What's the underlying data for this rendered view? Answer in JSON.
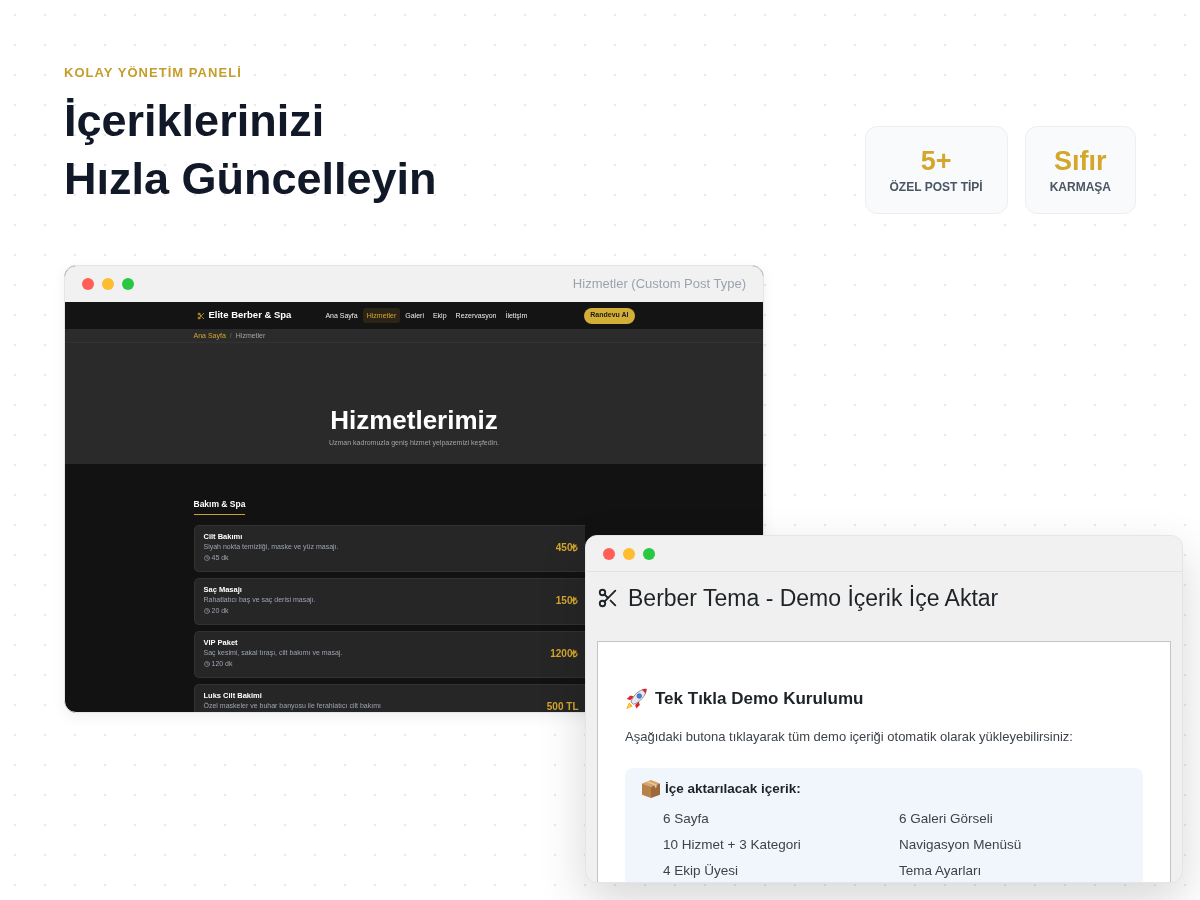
{
  "eyebrow": "KOLAY YÖNETİM PANELİ",
  "heading": [
    "İçeriklerinizi",
    "Hızla Güncelleyin"
  ],
  "stats": [
    {
      "value": "5+",
      "label": "ÖZEL POST TİPİ"
    },
    {
      "value": "Sıfır",
      "label": "KARMAŞA"
    }
  ],
  "preview_window": {
    "title": "Hizmetler (Custom Post Type)",
    "site": {
      "brand": "Elite Berber & Spa",
      "nav": [
        {
          "label": "Ana Sayfa",
          "selected": false
        },
        {
          "label": "Hizmetler",
          "selected": true
        },
        {
          "label": "Galeri",
          "selected": false
        },
        {
          "label": "Ekip",
          "selected": false
        },
        {
          "label": "Rezervasyon",
          "selected": false
        },
        {
          "label": "İletişim",
          "selected": false
        }
      ],
      "cta": "Randevu Al",
      "breadcrumb": [
        {
          "label": "Ana Sayfa",
          "kind": "link"
        },
        {
          "label": "/",
          "kind": "separator"
        },
        {
          "label": "Hizmetler",
          "kind": "current"
        }
      ],
      "hero": {
        "title": "Hizmetlerimiz",
        "subtitle": "Uzman kadromuzla geniş hizmet yelpazemizi keşfedin."
      },
      "category": "Bakım & Spa",
      "services": [
        {
          "name": "Cilt Bakımı",
          "description": "Siyah nokta temizliği, maske ve yüz masajı.",
          "duration": "45 dk",
          "price": "450₺"
        },
        {
          "name": "Saç Masajı",
          "description": "Rahatlatıcı baş ve saç derisi masajı.",
          "duration": "20 dk",
          "price": "150₺"
        },
        {
          "name": "VIP Paket",
          "description": "Saç kesimi, sakal tıraşı, cilt bakımı ve masaj.",
          "duration": "120 dk",
          "price": "1200₺"
        },
        {
          "name": "Luks Cilt Bakimi",
          "description": "Özel maskeler ve buhar banyosu ile ferahlatıcı cilt bakımı",
          "price": "500 TL"
        }
      ]
    }
  },
  "import_window": {
    "title": "Berber Tema - Demo İçerik İçe Aktar",
    "panel": {
      "heading": "Tek Tıkla Demo Kurulumu",
      "text": "Aşağıdaki butona tıklayarak tüm demo içeriği otomatik olarak yükleyebilirsiniz:",
      "info": {
        "heading": "İçe aktarılacak içerik:",
        "items": [
          "6 Sayfa",
          "6 Galeri Görseli",
          "10 Hizmet + 3 Kategori",
          "Navigasyon Menüsü",
          "4 Ekip Üyesi",
          "Tema Ayarları"
        ]
      }
    }
  }
}
